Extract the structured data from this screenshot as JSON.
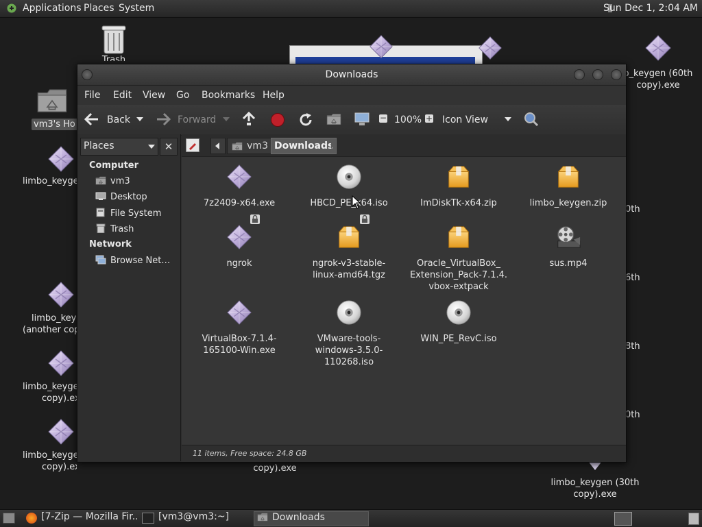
{
  "topbar": {
    "menus": [
      "Applications",
      "Places",
      "System"
    ],
    "clock": "Sun Dec 1,  2:04 AM"
  },
  "desktop": {
    "trash_label": "Trash",
    "home_label": "vm3's Ho",
    "right_icon_line1": "o_keygen (60th",
    "right_icon_line2": "copy).exe",
    "left_icons": [
      {
        "line1": "limbo_keyge",
        "line2": ""
      },
      {
        "line1": "limbo_keyge",
        "line2": "(another cop"
      },
      {
        "line1": "limbo_keyge",
        "line2": "copy).exe"
      },
      {
        "line1": "limbo_keyge",
        "line2": "copy).exe"
      }
    ],
    "peek_right": [
      "0th",
      "6th",
      "8th",
      "0th"
    ],
    "under_window": "copy).exe",
    "bottom_right_line1": "limbo_keygen (30th",
    "bottom_right_line2": "copy).exe"
  },
  "window": {
    "title": "Downloads",
    "menu": [
      "File",
      "Edit",
      "View",
      "Go",
      "Bookmarks",
      "Help"
    ],
    "toolbar": {
      "back": "Back",
      "forward": "Forward",
      "zoom": "100%",
      "view_mode": "Icon View"
    },
    "sidebar": {
      "header": "Places",
      "close": "✕",
      "sections": [
        {
          "title": "Computer",
          "items": [
            "vm3",
            "Desktop",
            "File System",
            "Trash"
          ]
        },
        {
          "title": "Network",
          "items": [
            "Browse Net…"
          ]
        }
      ]
    },
    "path": [
      "vm3",
      "Downloads"
    ],
    "files": [
      {
        "line1": "7z2409-x64.exe",
        "line2": "",
        "line3": "",
        "icon": "exe-icon"
      },
      {
        "line1": "HBCD_PE_x64.iso",
        "line2": "",
        "line3": "",
        "icon": "disc-icon"
      },
      {
        "line1": "ImDiskTk-x64.zip",
        "line2": "",
        "line3": "",
        "icon": "archive-icon"
      },
      {
        "line1": "limbo_keygen.zip",
        "line2": "",
        "line3": "",
        "icon": "archive-icon"
      },
      {
        "line1": "ngrok",
        "line2": "",
        "line3": "",
        "icon": "exe-icon"
      },
      {
        "line1": "ngrok-v3-stable-",
        "line2": "linux-amd64.tgz",
        "line3": "",
        "icon": "archive-icon"
      },
      {
        "line1": "Oracle_VirtualBox_",
        "line2": "Extension_Pack-7.1.4.",
        "line3": "vbox-extpack",
        "icon": "archive-icon"
      },
      {
        "line1": "sus.mp4",
        "line2": "",
        "line3": "",
        "icon": "video-icon"
      },
      {
        "line1": "VirtualBox-7.1.4-",
        "line2": "165100-Win.exe",
        "line3": "",
        "icon": "exe-icon"
      },
      {
        "line1": "VMware-tools-",
        "line2": "windows-3.5.0-",
        "line3": "110268.iso",
        "icon": "disc-icon"
      },
      {
        "line1": "WIN_PE_RevC.iso",
        "line2": "",
        "line3": "",
        "icon": "disc-icon"
      }
    ],
    "status": "11 items, Free space: 24.8 GB"
  },
  "taskbar": {
    "items": [
      "[7-Zip — Mozilla Fir...",
      "[vm3@vm3:~]",
      "Downloads"
    ]
  },
  "colors": {
    "gem": "#c8b8e0",
    "folder_orange": "#f3b23c",
    "stop_red": "#c0202a",
    "selection": "#5a5a5a"
  }
}
